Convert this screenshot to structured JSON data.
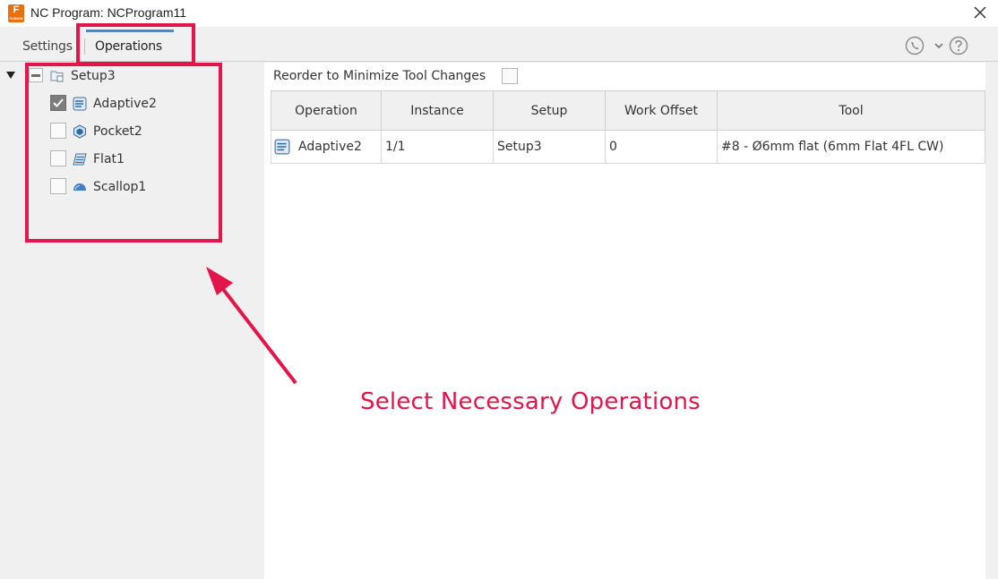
{
  "window": {
    "app_icon_letter": "F",
    "app_icon_sub": "FUSION",
    "title": "NC Program: NCProgram11"
  },
  "tabs": [
    {
      "label": "Settings",
      "active": false
    },
    {
      "label": "Operations",
      "active": true
    }
  ],
  "tree": {
    "setup": {
      "label": "Setup3",
      "state": "partial"
    },
    "operations": [
      {
        "label": "Adaptive2",
        "checked": true,
        "icon": "adaptive-icon"
      },
      {
        "label": "Pocket2",
        "checked": false,
        "icon": "pocket-icon"
      },
      {
        "label": "Flat1",
        "checked": false,
        "icon": "flat-icon"
      },
      {
        "label": "Scallop1",
        "checked": false,
        "icon": "scallop-icon"
      }
    ]
  },
  "reorder": {
    "label": "Reorder to Minimize Tool Changes",
    "checked": false
  },
  "table": {
    "columns": [
      "Operation",
      "Instance",
      "Setup",
      "Work Offset",
      "Tool"
    ],
    "rows": [
      {
        "operation": "Adaptive2",
        "instance": "1/1",
        "setup": "Setup3",
        "work_offset": "0",
        "tool": "#8 - Ø6mm flat (6mm Flat 4FL CW)"
      }
    ]
  },
  "annotation": {
    "text": "Select Necessary Operations"
  },
  "colors": {
    "highlight": "#e3154a",
    "accent": "#3a8fd6",
    "app_orange": "#e8700e"
  }
}
